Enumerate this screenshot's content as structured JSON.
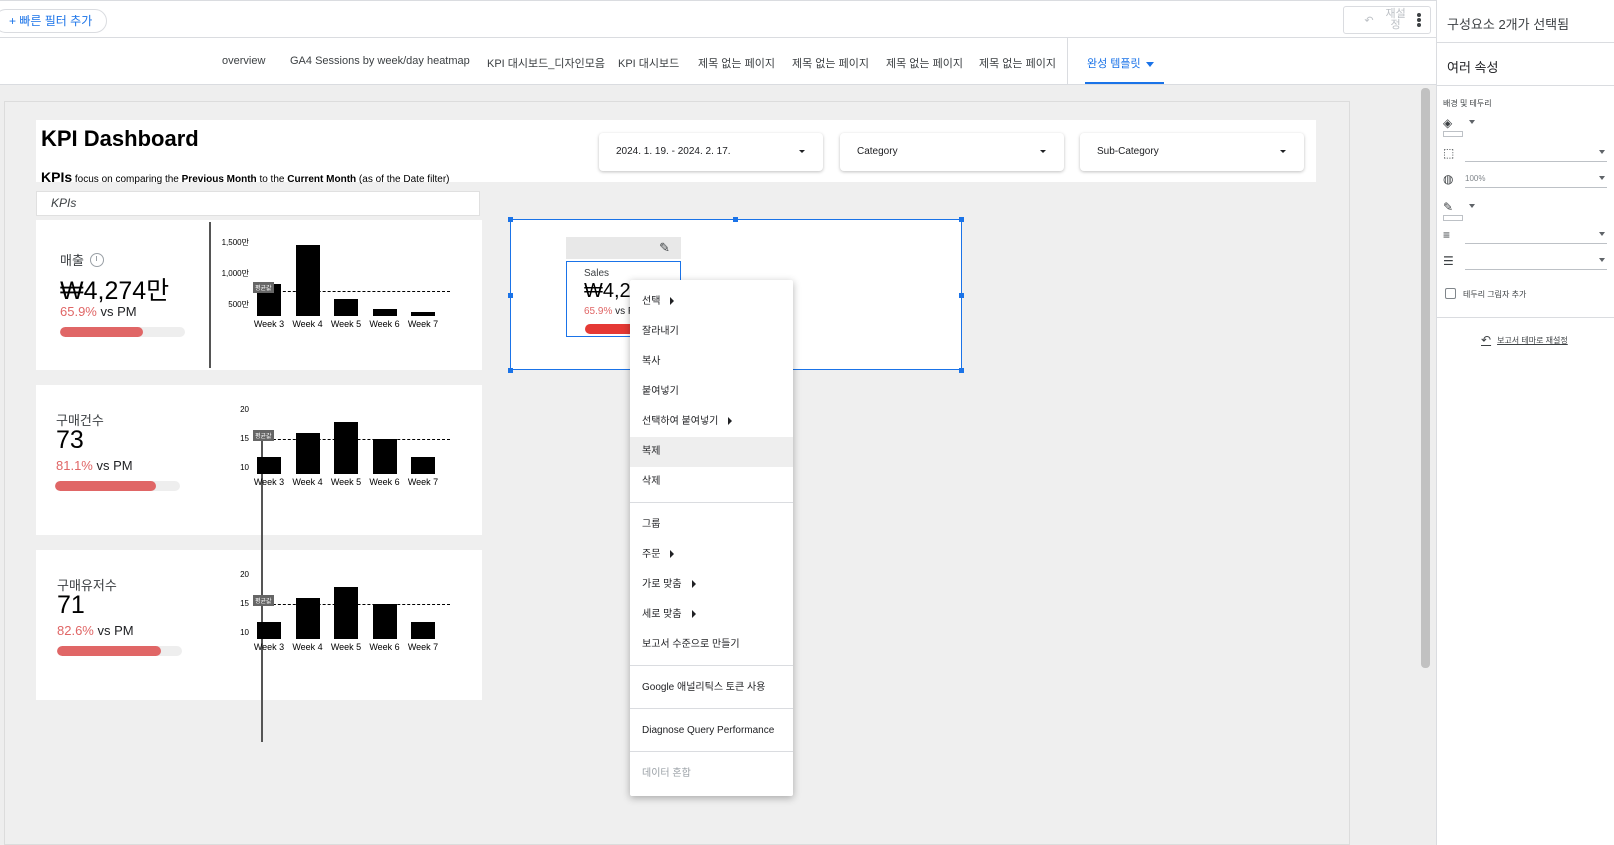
{
  "topbar": {
    "quick_filter_label": "+ 빠른 필터 추가",
    "reset_label": "재설정"
  },
  "right_panel": {
    "title": "구성요소 2개가 선택됨",
    "subtitle": "여러 속성",
    "section_label": "배경 및 테두리",
    "opacity_value": "100%",
    "shadow_label": "테두리 그림자 추가",
    "reset_theme_label": "보고서 테마로 재설정"
  },
  "tabs": [
    {
      "label": "overview"
    },
    {
      "label": "GA4 Sessions by week/day heatmap"
    },
    {
      "label": "KPI 대시보드_디자인모음"
    },
    {
      "label": "KPI 대시보드"
    },
    {
      "label": "제목 없는 페이지"
    },
    {
      "label": "제목 없는 페이지"
    },
    {
      "label": "제목 없는 페이지"
    },
    {
      "label": "제목 없는 페이지"
    },
    {
      "label": "완성 템플릿"
    }
  ],
  "dashboard": {
    "title": "KPI Dashboard",
    "subtitle_prefix": "KPIs",
    "subtitle_1": "focus on comparing the",
    "subtitle_prev": "Previous Month",
    "subtitle_2": "to the",
    "subtitle_curr": "Current Month",
    "subtitle_3": "(as of the Date filter)",
    "kpis_label": "KPIs"
  },
  "filters": {
    "date": "2024. 1. 19. - 2024. 2. 17.",
    "category": "Category",
    "subcategory": "Sub-Category"
  },
  "cards": [
    {
      "name": "매출",
      "value": "₩4,274만",
      "pct": "65.9%",
      "suffix": " vs PM",
      "progress": 0.66
    },
    {
      "name": "구매건수",
      "value": "73",
      "pct": "81.1%",
      "suffix": " vs PM",
      "progress": 0.81
    },
    {
      "name": "구매유저수",
      "value": "71",
      "pct": "82.6%",
      "suffix": " vs PM",
      "progress": 0.83
    }
  ],
  "chart_data": [
    {
      "type": "bar",
      "categories": [
        "Week 3",
        "Week 4",
        "Week 5",
        "Week 6",
        "Week 7"
      ],
      "values": [
        820,
        1450,
        570,
        420,
        360
      ],
      "yticks": [
        "1,500만",
        "1,000만",
        "500만"
      ],
      "avg_label": "평균값",
      "avg": 700
    },
    {
      "type": "bar",
      "categories": [
        "Week 3",
        "Week 4",
        "Week 5",
        "Week 6",
        "Week 7"
      ],
      "values": [
        12,
        16,
        18,
        15,
        12
      ],
      "yticks": [
        "20",
        "15",
        "10"
      ],
      "avg_label": "평균값",
      "avg": 15
    },
    {
      "type": "bar",
      "categories": [
        "Week 3",
        "Week 4",
        "Week 5",
        "Week 6",
        "Week 7"
      ],
      "values": [
        12,
        16,
        18,
        15,
        12
      ],
      "yticks": [
        "20",
        "15",
        "10"
      ],
      "avg_label": "평균값",
      "avg": 15
    }
  ],
  "selected": {
    "name": "Sales",
    "value": "₩4,27",
    "pct": "65.9%",
    "suffix": " vs P"
  },
  "context_menu": [
    {
      "label": "선택",
      "sub": true
    },
    {
      "label": "잘라내기"
    },
    {
      "label": "복사"
    },
    {
      "label": "붙여넣기"
    },
    {
      "label": "선택하여 붙여넣기",
      "sub": true
    },
    {
      "label": "복제"
    },
    {
      "label": "삭제"
    },
    {
      "label": "그룹"
    },
    {
      "label": "주문",
      "sub": true
    },
    {
      "label": "가로 맞춤",
      "sub": true
    },
    {
      "label": "세로 맞춤",
      "sub": true
    },
    {
      "label": "보고서 수준으로 만들기"
    },
    {
      "label": "Google 애널리틱스 토큰 사용"
    },
    {
      "label": "Diagnose Query Performance"
    },
    {
      "label": "데이터 혼합"
    }
  ]
}
